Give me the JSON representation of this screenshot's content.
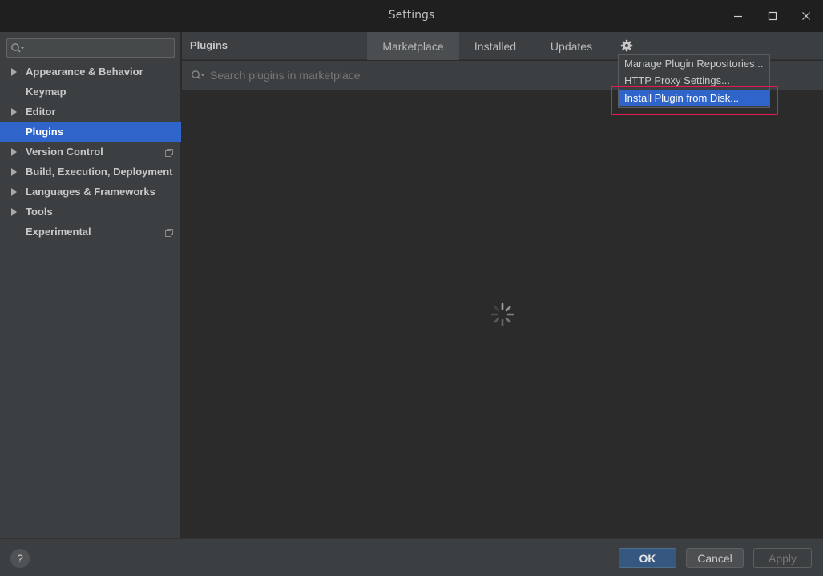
{
  "window": {
    "title": "Settings",
    "controls": [
      "minimize-icon",
      "maximize-icon",
      "close-icon"
    ]
  },
  "sidebar": {
    "search_placeholder": "",
    "items": [
      {
        "label": "Appearance & Behavior",
        "expandable": true,
        "selected": false,
        "project_icon": false
      },
      {
        "label": "Keymap",
        "expandable": false,
        "selected": false,
        "project_icon": false
      },
      {
        "label": "Editor",
        "expandable": true,
        "selected": false,
        "project_icon": false
      },
      {
        "label": "Plugins",
        "expandable": false,
        "selected": true,
        "project_icon": false
      },
      {
        "label": "Version Control",
        "expandable": true,
        "selected": false,
        "project_icon": true
      },
      {
        "label": "Build, Execution, Deployment",
        "expandable": true,
        "selected": false,
        "project_icon": false
      },
      {
        "label": "Languages & Frameworks",
        "expandable": true,
        "selected": false,
        "project_icon": false
      },
      {
        "label": "Tools",
        "expandable": true,
        "selected": false,
        "project_icon": false
      },
      {
        "label": "Experimental",
        "expandable": false,
        "selected": false,
        "project_icon": true
      }
    ]
  },
  "main": {
    "title": "Plugins",
    "tabs": [
      {
        "label": "Marketplace",
        "active": true
      },
      {
        "label": "Installed",
        "active": false
      },
      {
        "label": "Updates",
        "active": false
      }
    ],
    "search_placeholder": "Search plugins in marketplace",
    "loading": true
  },
  "gear_menu": {
    "items": [
      {
        "label": "Manage Plugin Repositories...",
        "highlighted": false
      },
      {
        "label": "HTTP Proxy Settings...",
        "highlighted": false
      },
      {
        "label": "Install Plugin from Disk...",
        "highlighted": true
      }
    ]
  },
  "footer": {
    "help_label": "?",
    "ok_label": "OK",
    "cancel_label": "Cancel",
    "apply_label": "Apply"
  },
  "colors": {
    "selection": "#2f65ca",
    "callout_box": "#e5194d",
    "ok_button": "#365880"
  }
}
